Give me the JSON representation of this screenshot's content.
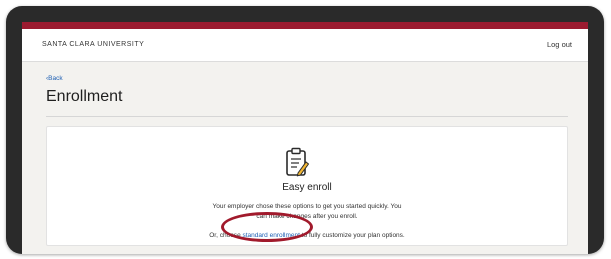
{
  "header": {
    "university_name": "SANTA CLARA UNIVERSITY",
    "logout_label": "Log out"
  },
  "nav": {
    "back_label": "‹Back"
  },
  "page": {
    "title": "Enrollment"
  },
  "card": {
    "icon": "clipboard-pencil-icon",
    "title": "Easy enroll",
    "description_line1": "Your employer chose these options to get you started quickly. You",
    "description_line2": "can make changes after you enroll.",
    "choose_prefix": "Or, choose ",
    "standard_link": "standard enrollment",
    "choose_suffix": " to fully customize your plan options."
  },
  "colors": {
    "brand": "#9b1b30",
    "link": "#1d5fb3",
    "highlight": "#a11a2c",
    "frame": "#2a2a2a"
  }
}
